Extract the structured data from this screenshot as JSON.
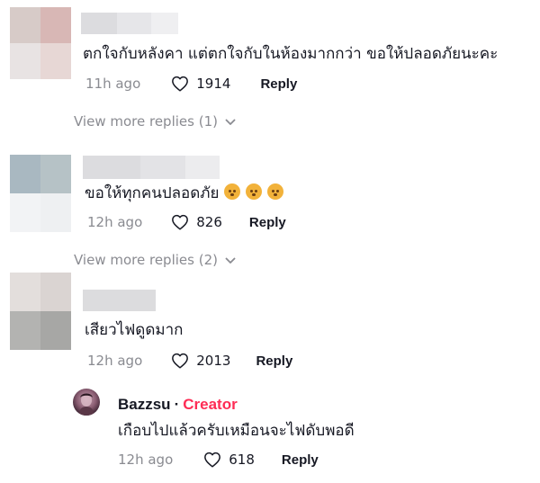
{
  "colors": {
    "creator_accent": "#fe2c55",
    "meta_gray": "#8a8b91",
    "text": "#161823"
  },
  "comments": [
    {
      "text": "ตกใจกับหลังคา แต่ตกใจกับในห้องมากกว่า ขอให้ปลอดภัยนะคะ",
      "time": "11h ago",
      "likes": "1914",
      "reply_label": "Reply",
      "view_more": "View more replies (1)"
    },
    {
      "text": "ขอให้ทุกคนปลอดภัย",
      "emoji_icons": [
        "pleading-face-icon",
        "pleading-face-icon",
        "pleading-face-icon"
      ],
      "time": "12h ago",
      "likes": "826",
      "reply_label": "Reply",
      "view_more": "View more replies (2)"
    },
    {
      "text": "เสียวไฟดูดมาก",
      "time": "12h ago",
      "likes": "2013",
      "reply_label": "Reply"
    }
  ],
  "creator_reply": {
    "username": "Bazzsu",
    "separator": "·",
    "badge": "Creator",
    "text": "เกือบไปแล้วครับเหมือนจะไฟดับพอดี",
    "time": "12h ago",
    "likes": "618",
    "reply_label": "Reply"
  }
}
